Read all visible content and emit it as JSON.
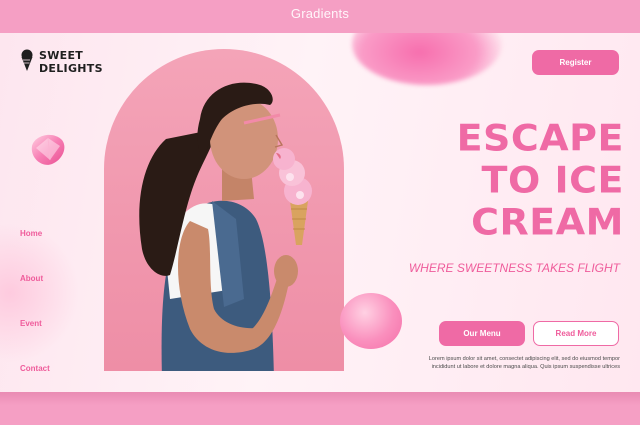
{
  "window": {
    "title": "Gradients"
  },
  "brand": {
    "line1": "SWEET",
    "line2": "DELIGHTS"
  },
  "nav": {
    "items": [
      "Home",
      "About",
      "Event",
      "Contact"
    ]
  },
  "header": {
    "register_label": "Register"
  },
  "hero": {
    "headline": [
      "ESCAPE",
      "TO ICE",
      "CREAM"
    ],
    "subheadline": "WHERE SWEETNESS TAKES FLIGHT",
    "primary_button": "Our Menu",
    "secondary_button": "Read More",
    "body_lines": [
      "Lorem ipsum dolor sit amet, consectet adipiscing elit, sed do eiusmod tempor",
      "incididunt ut labore et dolore magna aliqua. Quis ipsum suspendisse ultrices"
    ]
  },
  "colors": {
    "accent": "#ef6aa5",
    "background": "#f59fc4",
    "card": "#fdeef4"
  },
  "icons": {
    "logo": "ice-cream-icon",
    "decor": "gem-icon"
  }
}
